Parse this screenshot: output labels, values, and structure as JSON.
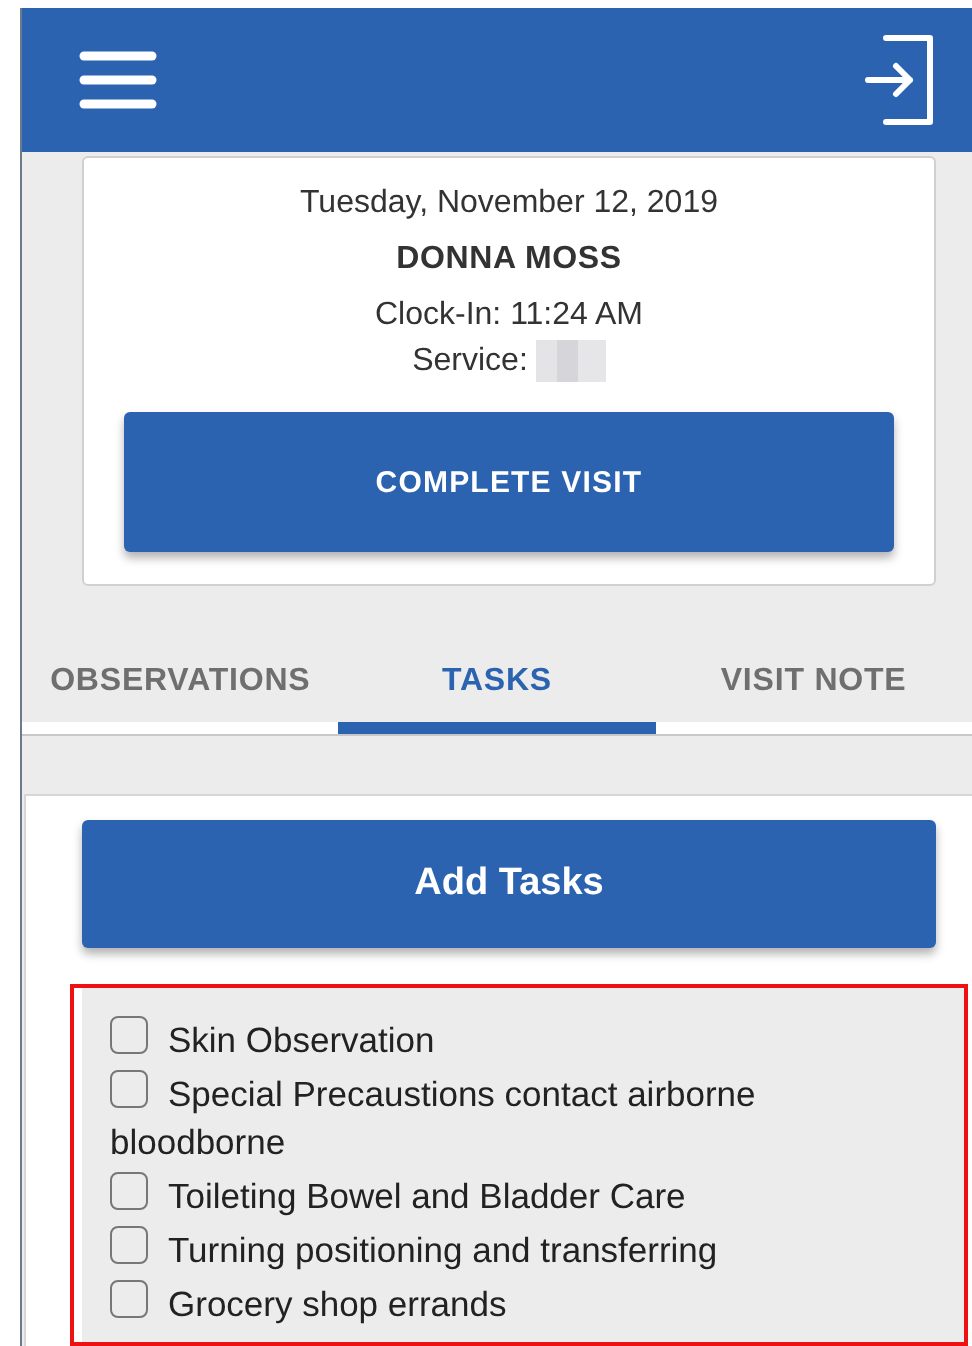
{
  "visit": {
    "date": "Tuesday, November 12, 2019",
    "client": "DONNA MOSS",
    "clock_in": "Clock-In: 11:24 AM",
    "service_label": "Service:",
    "service_redacted": true,
    "action": "COMPLETE VISIT"
  },
  "tabs": [
    {
      "label": "OBSERVATIONS",
      "selected": false
    },
    {
      "label": "TASKS",
      "selected": true
    },
    {
      "label": "VISIT NOTE",
      "selected": false
    }
  ],
  "add_button": "Add Tasks",
  "tasks": [
    {
      "label": "Skin Observation",
      "checked": false
    },
    {
      "label": "Special Precaustions contact airborne bloodborne",
      "checked": false
    },
    {
      "label": "Toileting Bowel and Bladder Care",
      "checked": false
    },
    {
      "label": "Turning positioning and transferring",
      "checked": false
    },
    {
      "label": "Grocery shop errands",
      "checked": false
    }
  ]
}
